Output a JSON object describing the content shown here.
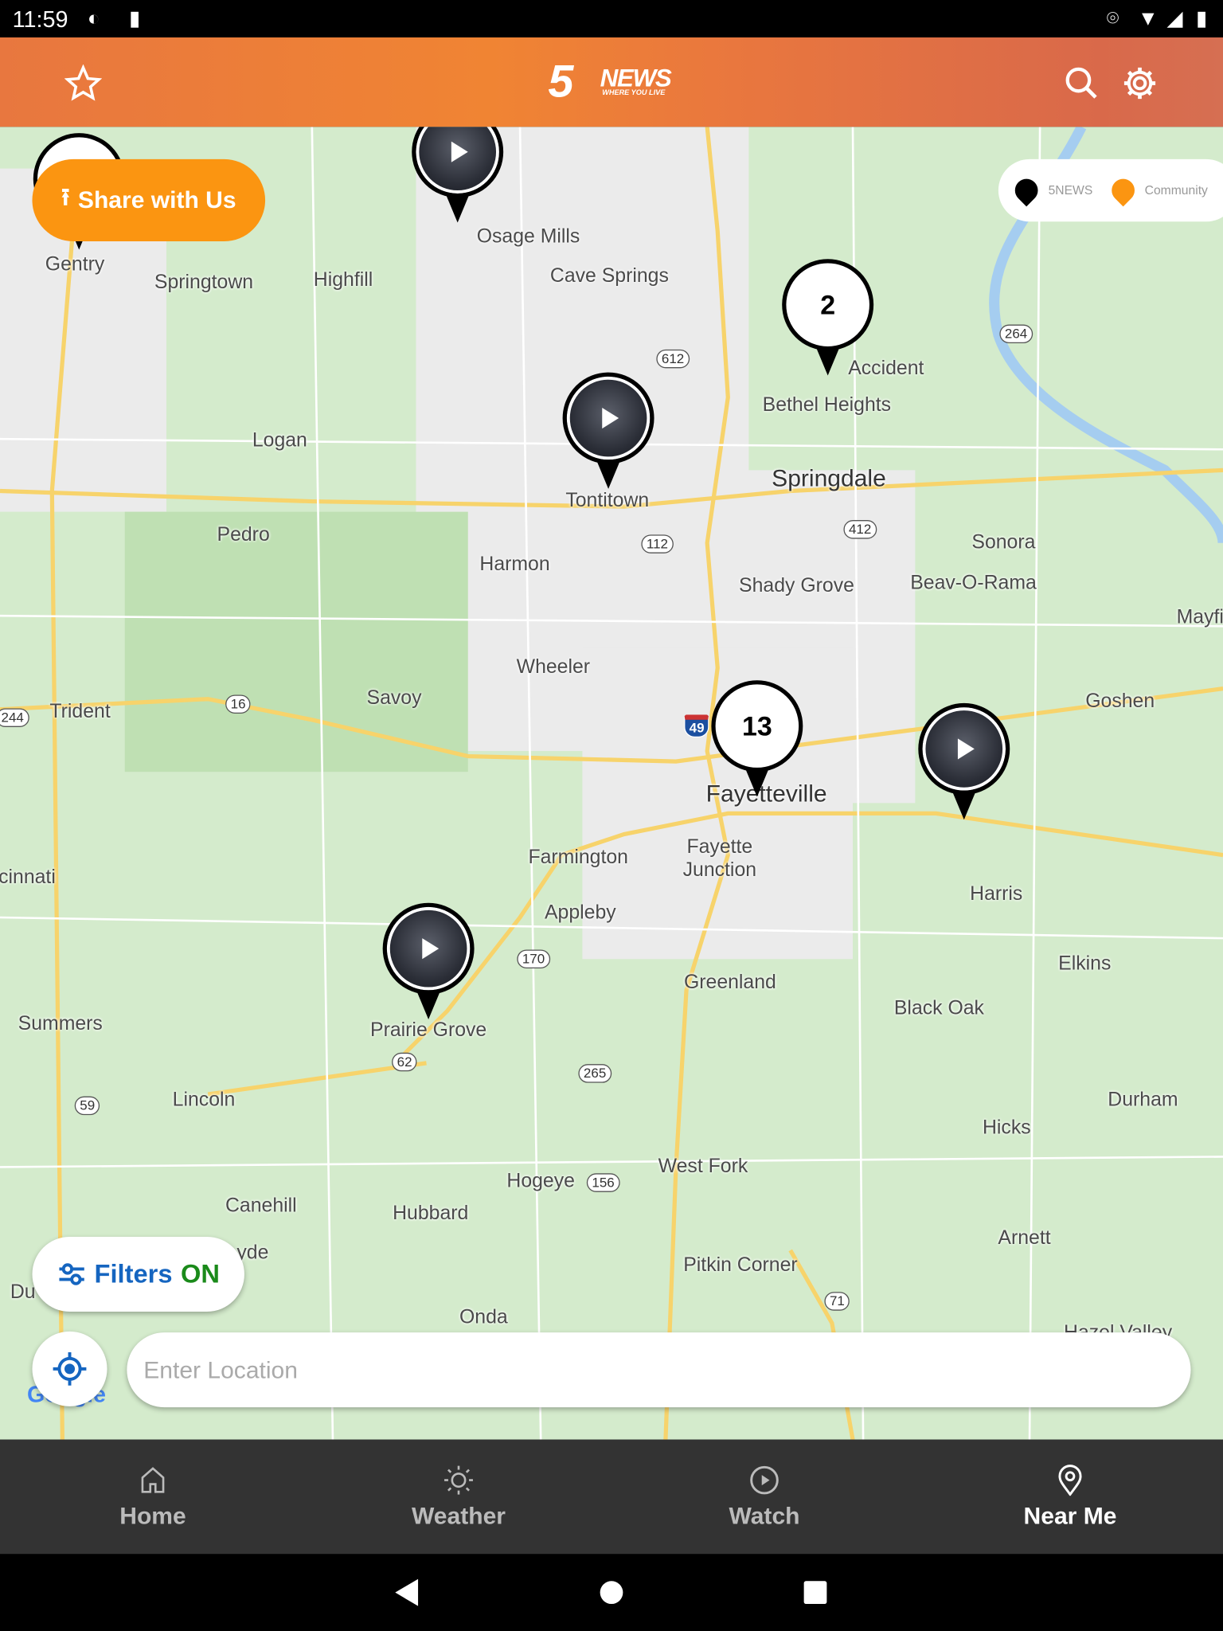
{
  "status_bar": {
    "time": "11:59"
  },
  "header": {
    "logo_text": "5 NEWS",
    "logo_tagline": "WHERE YOU LIVE",
    "favorite_icon": "star-icon",
    "search_icon": "search-icon",
    "settings_icon": "gear-icon"
  },
  "map": {
    "share_button": "Share with Us",
    "legend": [
      {
        "label": "5NEWS",
        "color": "#000000"
      },
      {
        "label": "Community",
        "color": "#fb9511"
      }
    ],
    "places": [
      "Gentry",
      "Springtown",
      "Highfill",
      "Osage Mills",
      "Cave Springs",
      "Accident",
      "Bethel Heights",
      "Logan",
      "Springdale",
      "Tontitown",
      "Pedro",
      "Harmon",
      "Sonora",
      "Shady Grove",
      "Beav-O-Rama",
      "Mayfi",
      "Wheeler",
      "Savoy",
      "Trident",
      "Goshen",
      "Fayetteville",
      "Farmington",
      "Fayette",
      "Junction",
      "Harris",
      "cinnati",
      "Appleby",
      "Elkins",
      "Greenland",
      "Black Oak",
      "Summers",
      "Prairie Grove",
      "Lincoln",
      "Durham",
      "Hicks",
      "West Fork",
      "Hogeye",
      "Canehill",
      "Hubbard",
      "Arnett",
      "Pitkin Corner",
      "Onda",
      "Hazel Valley",
      "Du",
      "yde"
    ],
    "highways": [
      "612",
      "264",
      "412",
      "112",
      "16",
      "244",
      "49",
      "170",
      "62",
      "265",
      "59",
      "156",
      "71"
    ],
    "clusters": [
      "2",
      "13"
    ],
    "filters": {
      "label": "Filters",
      "state": "ON"
    },
    "location_input": {
      "placeholder": "Enter Location",
      "value": ""
    },
    "google_attribution": "Google"
  },
  "bottom_nav": [
    {
      "label": "Home",
      "icon": "home-icon"
    },
    {
      "label": "Weather",
      "icon": "sun-icon"
    },
    {
      "label": "Watch",
      "icon": "play-circle-icon"
    },
    {
      "label": "Near Me",
      "icon": "location-pin-icon",
      "active": true
    }
  ],
  "colors": {
    "accent": "#fb9511",
    "filters_blue": "#1565c0",
    "filters_on_green": "#1a8a1a",
    "nav_bg": "#333333"
  }
}
